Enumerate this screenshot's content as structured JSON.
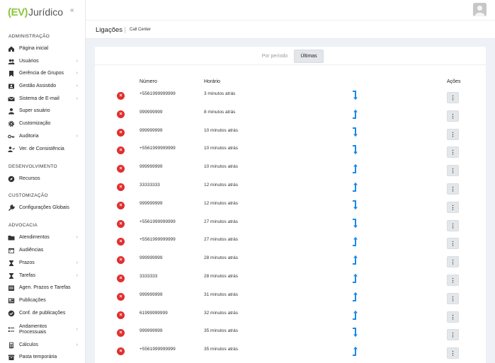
{
  "brand": {
    "logo_ev": "(EV)",
    "logo_text": "Jurídico",
    "collapse_glyph": "«"
  },
  "sidebar": {
    "sections": [
      {
        "label": "ADMINISTRAÇÃO"
      },
      {
        "label": "DESENVOLVIMENTO"
      },
      {
        "label": "CUSTOMIZAÇÃO"
      },
      {
        "label": "ADVOCACIA"
      }
    ],
    "items": [
      {
        "label": "Página inicial",
        "icon": "home-icon"
      },
      {
        "label": "Usuários",
        "icon": "users-icon",
        "chevron": true
      },
      {
        "label": "Gerência de Grupos",
        "icon": "bookmark-icon",
        "chevron": true
      },
      {
        "label": "Gestão Assistido",
        "icon": "id-card-icon",
        "chevron": true
      },
      {
        "label": "Sistema de E-mail",
        "icon": "mail-icon",
        "chevron": true
      },
      {
        "label": "Super usuário",
        "icon": "user-icon"
      },
      {
        "label": "Customização",
        "icon": "gear-icon"
      },
      {
        "label": "Auditoria",
        "icon": "key-icon",
        "chevron": true
      },
      {
        "label": "Ver. de Consistência",
        "icon": "user-check-icon"
      },
      {
        "label": "Recursos",
        "icon": "compass-icon"
      },
      {
        "label": "Configurações Globais",
        "icon": "wrench-icon"
      },
      {
        "label": "Atendimentos",
        "icon": "folder-icon",
        "chevron": true
      },
      {
        "label": "Audiências",
        "icon": "calendar-icon"
      },
      {
        "label": "Prazos",
        "icon": "hourglass-icon",
        "chevron": true
      },
      {
        "label": "Tarefas",
        "icon": "tasks-icon",
        "chevron": true
      },
      {
        "label": "Agen. Prazos e Tarefas",
        "icon": "agenda-icon"
      },
      {
        "label": "Publicações",
        "icon": "newspaper-icon"
      },
      {
        "label": "Conf. de publicações",
        "icon": "check-circle-icon"
      },
      {
        "label": "Andamentos Processuais",
        "icon": "list-icon",
        "chevron": true
      },
      {
        "label": "Cálculos",
        "icon": "calculator-icon",
        "chevron": true
      },
      {
        "label": "Pasta temporária",
        "icon": "archive-icon"
      }
    ]
  },
  "header": {
    "title": "Ligações",
    "breadcrumb": "Call Center"
  },
  "tabs": [
    {
      "label": "Por período"
    },
    {
      "label": "Últimas"
    }
  ],
  "table": {
    "columns": {
      "number": "Número",
      "time": "Horário",
      "actions": "Ações"
    },
    "rows": [
      {
        "number": "+5561999999999",
        "time": "3 minutos atrás",
        "direction": "down"
      },
      {
        "number": "999999999",
        "time": "8 minutos atrás",
        "direction": "up"
      },
      {
        "number": "999999999",
        "time": "10 minutos atrás",
        "direction": "down"
      },
      {
        "number": "+5561999999999",
        "time": "10 minutos atrás",
        "direction": "down"
      },
      {
        "number": "999999999",
        "time": "10 minutos atrás",
        "direction": "up"
      },
      {
        "number": "33333333",
        "time": "12 minutos atrás",
        "direction": "up"
      },
      {
        "number": "999999999",
        "time": "12 minutos atrás",
        "direction": "down"
      },
      {
        "number": "+5561999999999",
        "time": "27 minutos atrás",
        "direction": "down"
      },
      {
        "number": "+5561999999999",
        "time": "27 minutos atrás",
        "direction": "up"
      },
      {
        "number": "999999999",
        "time": "28 minutos atrás",
        "direction": "up"
      },
      {
        "number": "3333333",
        "time": "28 minutos atrás",
        "direction": "up"
      },
      {
        "number": "999999999",
        "time": "31 minutos atrás",
        "direction": "up"
      },
      {
        "number": "61999999999",
        "time": "32 minutos atrás",
        "direction": "up"
      },
      {
        "number": "999999999",
        "time": "35 minutos atrás",
        "direction": "down"
      },
      {
        "number": "+5561999999999",
        "time": "35 minutos atrás",
        "direction": "up"
      }
    ],
    "delete_glyph": "×",
    "action_glyph": "⋮"
  },
  "colors": {
    "accent_green": "#8cc63f",
    "delete_red": "#e0302f",
    "arrow_blue": "#1e88e5"
  }
}
